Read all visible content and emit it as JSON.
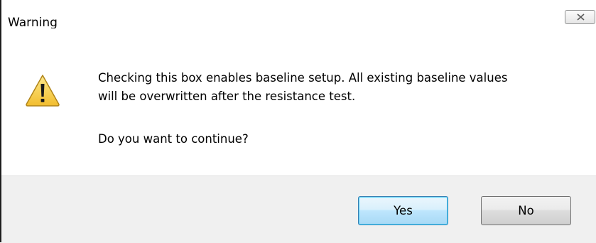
{
  "window": {
    "title": "Warning"
  },
  "icons": {
    "warning": "warning-icon",
    "close": "close-icon"
  },
  "message": {
    "line1": "Checking this box enables baseline setup. All existing baseline values",
    "line2": "will be overwritten after the resistance test.",
    "question": "Do you want to continue?"
  },
  "buttons": {
    "yes_label": "Yes",
    "no_label": "No"
  },
  "colors": {
    "footer_bg": "#f0f0f0",
    "default_button_border": "#3c7fb1",
    "warning_yellow": "#f5c542"
  }
}
